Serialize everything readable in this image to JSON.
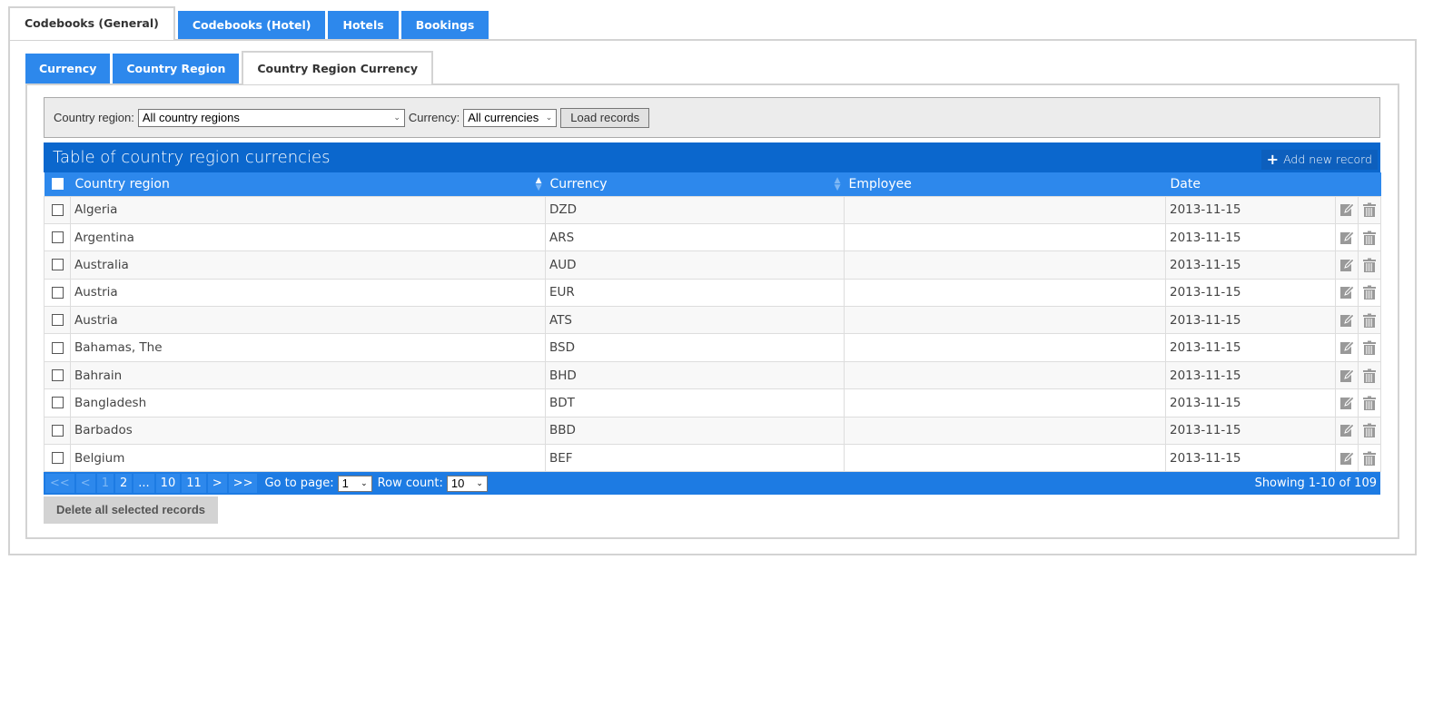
{
  "outer_tabs": [
    {
      "label": "Codebooks (General)",
      "active": true
    },
    {
      "label": "Codebooks (Hotel)",
      "active": false
    },
    {
      "label": "Hotels",
      "active": false
    },
    {
      "label": "Bookings",
      "active": false
    }
  ],
  "inner_tabs": [
    {
      "label": "Currency",
      "active": false
    },
    {
      "label": "Country Region",
      "active": false
    },
    {
      "label": "Country Region Currency",
      "active": true
    }
  ],
  "filter": {
    "country_region_label": "Country region:",
    "country_region_value": "All country regions",
    "currency_label": "Currency:",
    "currency_value": "All currencies",
    "load_button": "Load records"
  },
  "table": {
    "title": "Table of country region currencies",
    "add_button": "Add new record",
    "columns": [
      "Country region",
      "Currency",
      "Employee",
      "Date"
    ],
    "rows": [
      {
        "country_region": "Algeria",
        "currency": "DZD",
        "employee": "",
        "date": "2013-11-15"
      },
      {
        "country_region": "Argentina",
        "currency": "ARS",
        "employee": "",
        "date": "2013-11-15"
      },
      {
        "country_region": "Australia",
        "currency": "AUD",
        "employee": "",
        "date": "2013-11-15"
      },
      {
        "country_region": "Austria",
        "currency": "EUR",
        "employee": "",
        "date": "2013-11-15"
      },
      {
        "country_region": "Austria",
        "currency": "ATS",
        "employee": "",
        "date": "2013-11-15"
      },
      {
        "country_region": "Bahamas, The",
        "currency": "BSD",
        "employee": "",
        "date": "2013-11-15"
      },
      {
        "country_region": "Bahrain",
        "currency": "BHD",
        "employee": "",
        "date": "2013-11-15"
      },
      {
        "country_region": "Bangladesh",
        "currency": "BDT",
        "employee": "",
        "date": "2013-11-15"
      },
      {
        "country_region": "Barbados",
        "currency": "BBD",
        "employee": "",
        "date": "2013-11-15"
      },
      {
        "country_region": "Belgium",
        "currency": "BEF",
        "employee": "",
        "date": "2013-11-15"
      }
    ]
  },
  "pager": {
    "buttons": [
      {
        "label": "<<",
        "disabled": true,
        "name": "first-page-button"
      },
      {
        "label": "<",
        "disabled": true,
        "name": "prev-page-button"
      },
      {
        "label": "1",
        "disabled": true,
        "name": "page-1-button"
      },
      {
        "label": "2",
        "disabled": false,
        "name": "page-2-button"
      },
      {
        "label": "...",
        "disabled": false,
        "name": "page-ellipsis-button"
      },
      {
        "label": "10",
        "disabled": false,
        "name": "page-10-button"
      },
      {
        "label": "11",
        "disabled": false,
        "name": "page-11-button"
      },
      {
        "label": ">",
        "disabled": false,
        "name": "next-page-button"
      },
      {
        "label": ">>",
        "disabled": false,
        "name": "last-page-button"
      }
    ],
    "goto_label": "Go to page:",
    "goto_value": "1",
    "rowcount_label": "Row count:",
    "rowcount_value": "10",
    "showing": "Showing 1-10 of 109"
  },
  "delete_selected_button": "Delete all selected records"
}
